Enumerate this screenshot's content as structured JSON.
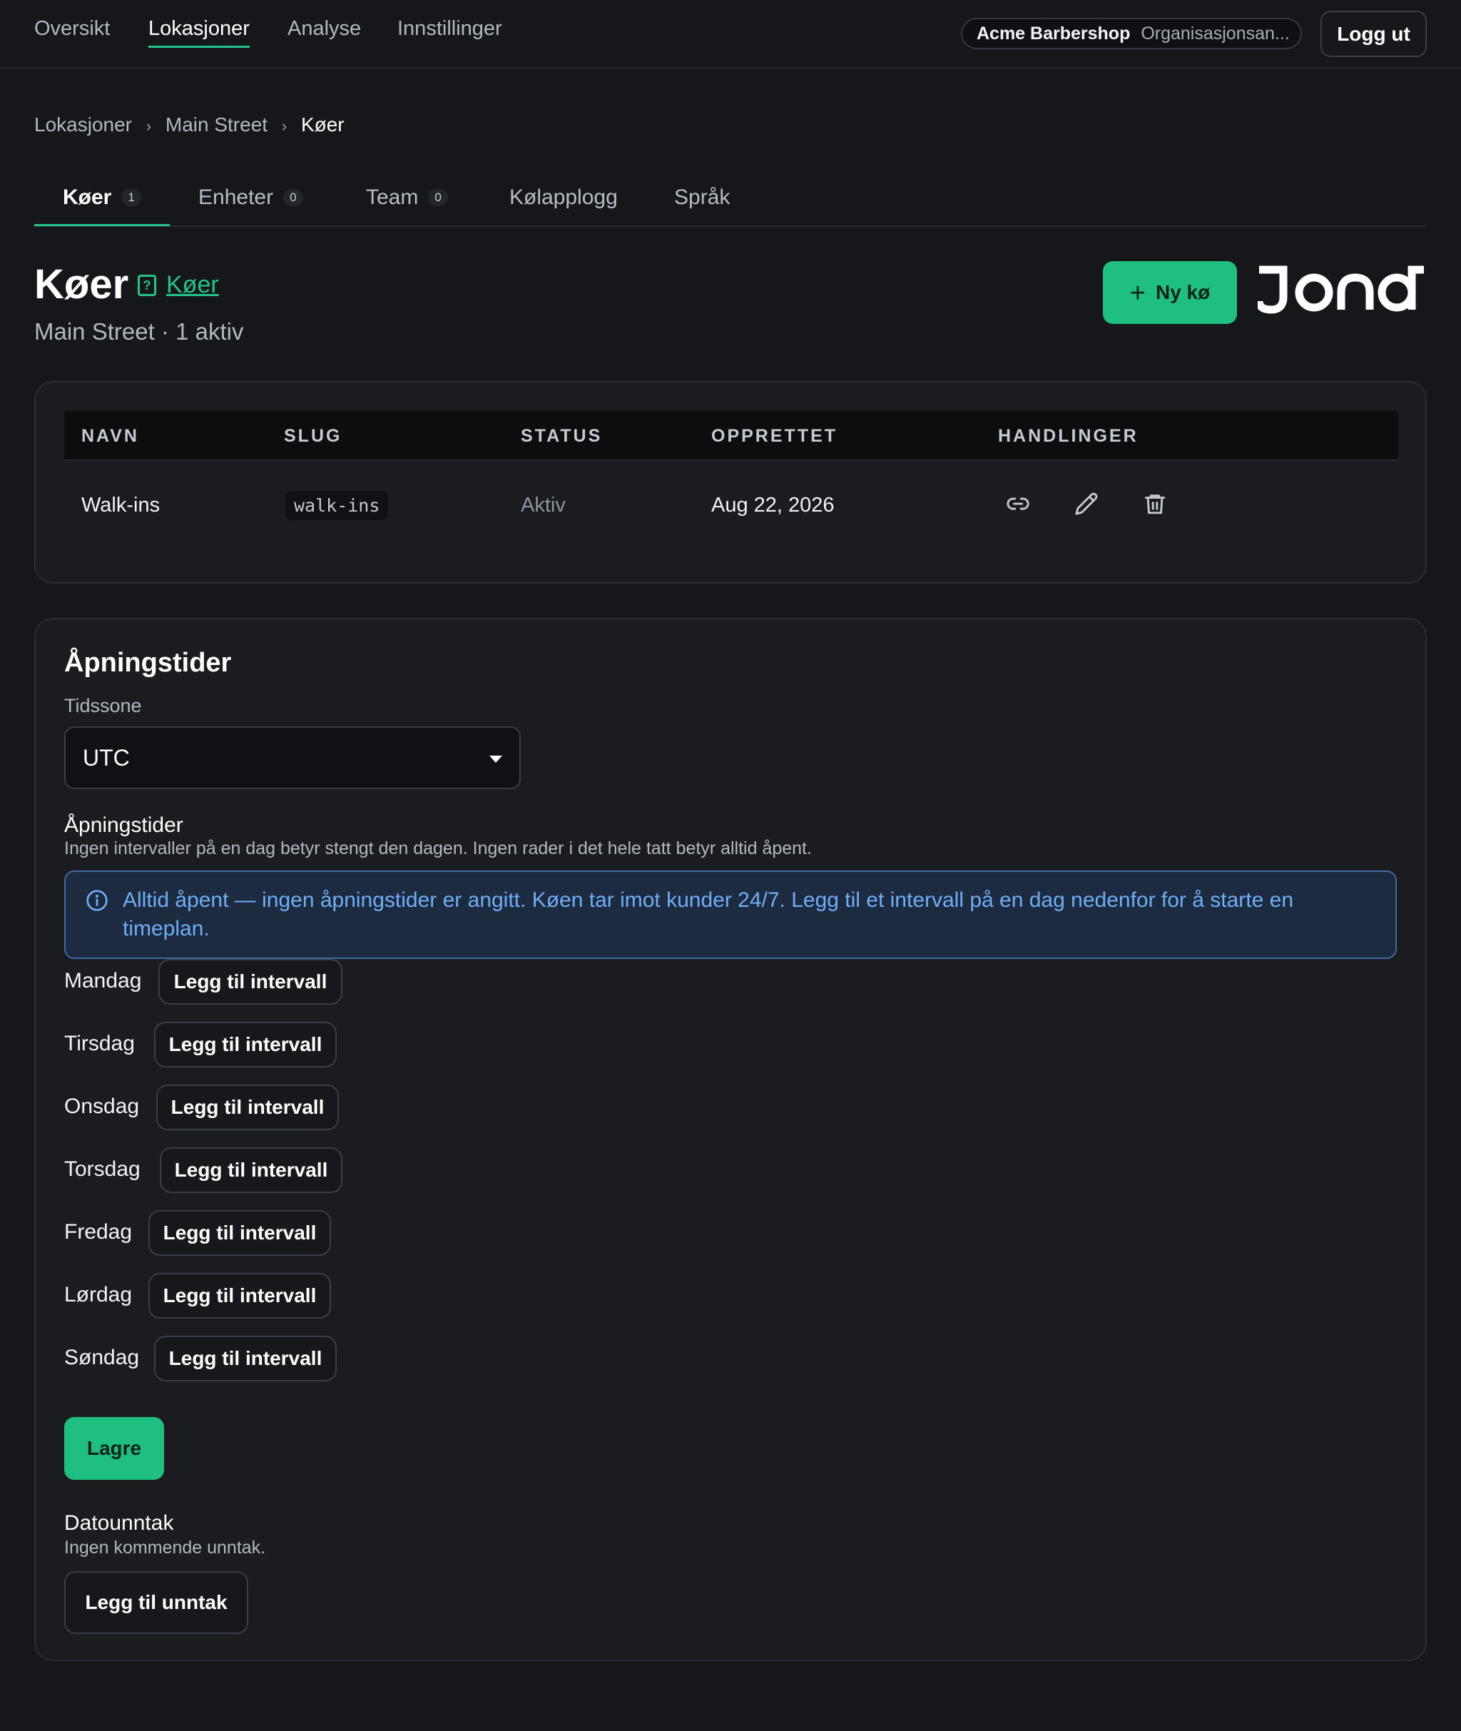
{
  "nav": {
    "items": [
      "Oversikt",
      "Lokasjoner",
      "Analyse",
      "Innstillinger"
    ],
    "active_index": 1,
    "org_name": "Acme Barbershop",
    "org_role": "Organisasjonsan...",
    "logout_label": "Logg ut"
  },
  "breadcrumb": [
    "Lokasjoner",
    "Main Street",
    "Køer"
  ],
  "tabs": [
    {
      "label": "Køer",
      "count": "1"
    },
    {
      "label": "Enheter",
      "count": "0"
    },
    {
      "label": "Team",
      "count": "0"
    },
    {
      "label": "Kølapplogg"
    },
    {
      "label": "Språk"
    }
  ],
  "header": {
    "title": "Køer",
    "help_link": "Køer",
    "subtitle": "Main Street · 1 aktiv",
    "new_button": "Ny kø",
    "logo_text": "JONOT"
  },
  "queues_table": {
    "columns": [
      "NAVN",
      "SLUG",
      "STATUS",
      "OPPRETTET",
      "HANDLINGER"
    ],
    "rows": [
      {
        "name": "Walk-ins",
        "slug": "walk-ins",
        "status": "Aktiv",
        "created": "Aug 22, 2026"
      }
    ]
  },
  "hours": {
    "title": "Åpningstider",
    "timezone_label": "Tidssone",
    "timezone_value": "UTC",
    "section_title": "Åpningstider",
    "section_hint": "Ingen intervaller på en dag betyr stengt den dagen. Ingen rader i det hele tatt betyr alltid åpent.",
    "info": "Alltid åpent — ingen åpningstider er angitt. Køen tar imot kunder 24/7. Legg til et intervall på en dag nedenfor for å starte en timeplan.",
    "add_interval_label": "Legg til intervall",
    "days": [
      "Mandag",
      "Tirsdag",
      "Onsdag",
      "Torsdag",
      "Fredag",
      "Lørdag",
      "Søndag"
    ],
    "save_label": "Lagre",
    "exceptions_title": "Datounntak",
    "exceptions_hint": "Ingen kommende unntak.",
    "add_exception_label": "Legg til unntak"
  },
  "colors": {
    "accent": "#1fc07f",
    "info_text": "#6eaef5",
    "background": "#15171b"
  }
}
